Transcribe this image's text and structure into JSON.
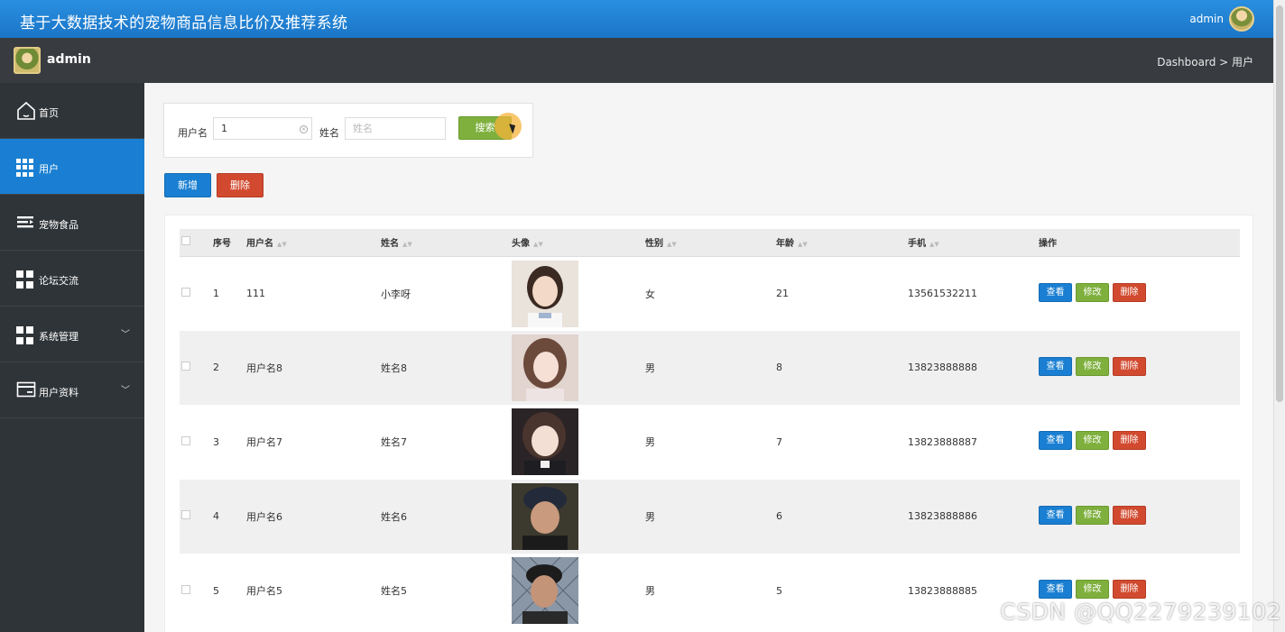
{
  "app": {
    "title": "基于大数据技术的宠物商品信息比价及推荐系统",
    "top_user": "admin"
  },
  "subbar": {
    "name": "admin",
    "breadcrumb": "Dashboard > 用户"
  },
  "sidebar": {
    "items": [
      {
        "label": "首页",
        "icon": "home-icon"
      },
      {
        "label": "用户",
        "icon": "grid9-icon",
        "active": true
      },
      {
        "label": "宠物食品",
        "icon": "list-icon"
      },
      {
        "label": "论坛交流",
        "icon": "grid4-icon"
      },
      {
        "label": "系统管理",
        "icon": "grid4-icon",
        "expandable": true
      },
      {
        "label": "用户资料",
        "icon": "card-icon",
        "expandable": true
      }
    ]
  },
  "search": {
    "username_label": "用户名",
    "username_value": "1",
    "name_label": "姓名",
    "name_placeholder": "姓名",
    "search_button": "搜索"
  },
  "actions": {
    "add": "新增",
    "delete": "删除"
  },
  "table": {
    "headers": [
      "序号",
      "用户名",
      "姓名",
      "头像",
      "性别",
      "年龄",
      "手机",
      "操作"
    ],
    "row_buttons": {
      "view": "查看",
      "edit": "修改",
      "delete": "删除"
    },
    "rows": [
      {
        "no": "1",
        "username": "111",
        "name": "小李呀",
        "gender": "女",
        "age": "21",
        "phone": "13561532211"
      },
      {
        "no": "2",
        "username": "用户名8",
        "name": "姓名8",
        "gender": "男",
        "age": "8",
        "phone": "13823888888"
      },
      {
        "no": "3",
        "username": "用户名7",
        "name": "姓名7",
        "gender": "男",
        "age": "7",
        "phone": "13823888887"
      },
      {
        "no": "4",
        "username": "用户名6",
        "name": "姓名6",
        "gender": "男",
        "age": "6",
        "phone": "13823888886"
      },
      {
        "no": "5",
        "username": "用户名5",
        "name": "姓名5",
        "gender": "男",
        "age": "5",
        "phone": "13823888885"
      }
    ]
  },
  "colors": {
    "primary": "#1a7fd2",
    "success": "#7fb03e",
    "danger": "#d14a2f",
    "sidebar": "#2f3438"
  },
  "watermark": "CSDN @QQ2279239102"
}
